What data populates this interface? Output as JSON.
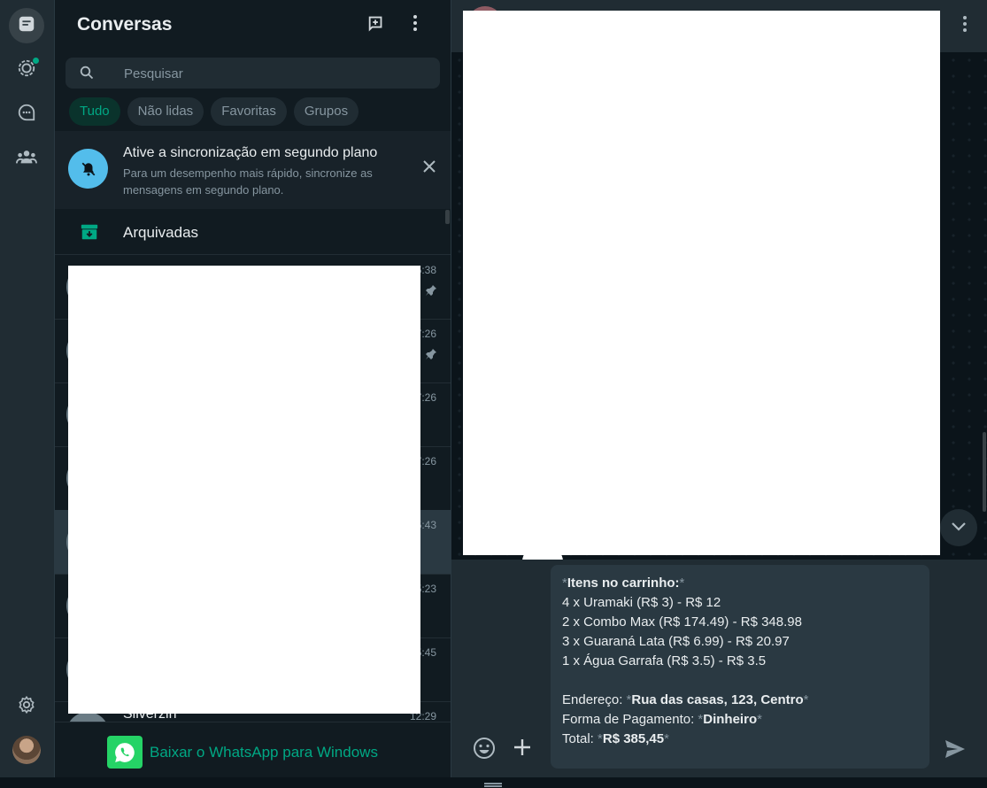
{
  "rail": {
    "items": [
      {
        "name": "chats-icon",
        "active": true
      },
      {
        "name": "status-icon",
        "active": false,
        "badge": true
      },
      {
        "name": "channels-icon",
        "active": false
      },
      {
        "name": "communities-icon",
        "active": false
      }
    ],
    "bottom": [
      "settings-icon",
      "profile-avatar"
    ]
  },
  "sidebar": {
    "title": "Conversas",
    "search_placeholder": "Pesquisar",
    "filters": [
      {
        "label": "Tudo",
        "active": true
      },
      {
        "label": "Não lidas",
        "active": false
      },
      {
        "label": "Favoritas",
        "active": false
      },
      {
        "label": "Grupos",
        "active": false
      }
    ],
    "banner": {
      "title": "Ative a sincronização em segundo plano",
      "body": "Para um desempenho mais rápido, sincronize as mensagens em segundo plano."
    },
    "archived_label": "Arquivadas",
    "chats": [
      {
        "time": "5:38",
        "pinned": true
      },
      {
        "time": "7:26",
        "pinned": true
      },
      {
        "time": "7:26",
        "pinned": false
      },
      {
        "time": "7:26",
        "pinned": false
      },
      {
        "time": "5:43",
        "pinned": false,
        "selected": true
      },
      {
        "time": "5:23",
        "pinned": false
      },
      {
        "time": "5:45",
        "pinned": false
      },
      {
        "name": "Silverzin",
        "time": "12:29",
        "pinned": false
      }
    ],
    "download_label": "Baixar o WhatsApp para Windows"
  },
  "composer": {
    "lines": [
      {
        "segments": [
          {
            "t": "*",
            "s": "ast"
          },
          {
            "t": "Itens no carrinho:",
            "s": "bold"
          },
          {
            "t": "*",
            "s": "ast"
          }
        ]
      },
      {
        "segments": [
          {
            "t": "4 x Uramaki (R$ 3) - R$ 12",
            "s": ""
          }
        ]
      },
      {
        "segments": [
          {
            "t": "2 x Combo Max (R$ 174.49) - R$ 348.98",
            "s": ""
          }
        ]
      },
      {
        "segments": [
          {
            "t": "3 x Guaraná Lata (R$ 6.99) - R$ 20.97",
            "s": ""
          }
        ]
      },
      {
        "segments": [
          {
            "t": "1 x Água Garrafa (R$ 3.5) - R$ 3.5",
            "s": ""
          }
        ]
      },
      {
        "segments": []
      },
      {
        "segments": [
          {
            "t": "Endereço: ",
            "s": ""
          },
          {
            "t": "*",
            "s": "ast"
          },
          {
            "t": "Rua das casas, 123, Centro",
            "s": "bold"
          },
          {
            "t": "*",
            "s": "ast"
          }
        ]
      },
      {
        "segments": [
          {
            "t": "Forma de Pagamento: ",
            "s": ""
          },
          {
            "t": "*",
            "s": "ast"
          },
          {
            "t": "Dinheiro",
            "s": "bold"
          },
          {
            "t": "*",
            "s": "ast"
          }
        ]
      },
      {
        "segments": [
          {
            "t": "Total: ",
            "s": ""
          },
          {
            "t": "*",
            "s": "ast"
          },
          {
            "t": "R$ 385,45",
            "s": "bold"
          },
          {
            "t": "*",
            "s": "ast"
          }
        ]
      }
    ]
  },
  "colors": {
    "accent": "#00a884",
    "banner_icon": "#53bdeb",
    "panel": "#202c33",
    "sidebar": "#111b21"
  }
}
